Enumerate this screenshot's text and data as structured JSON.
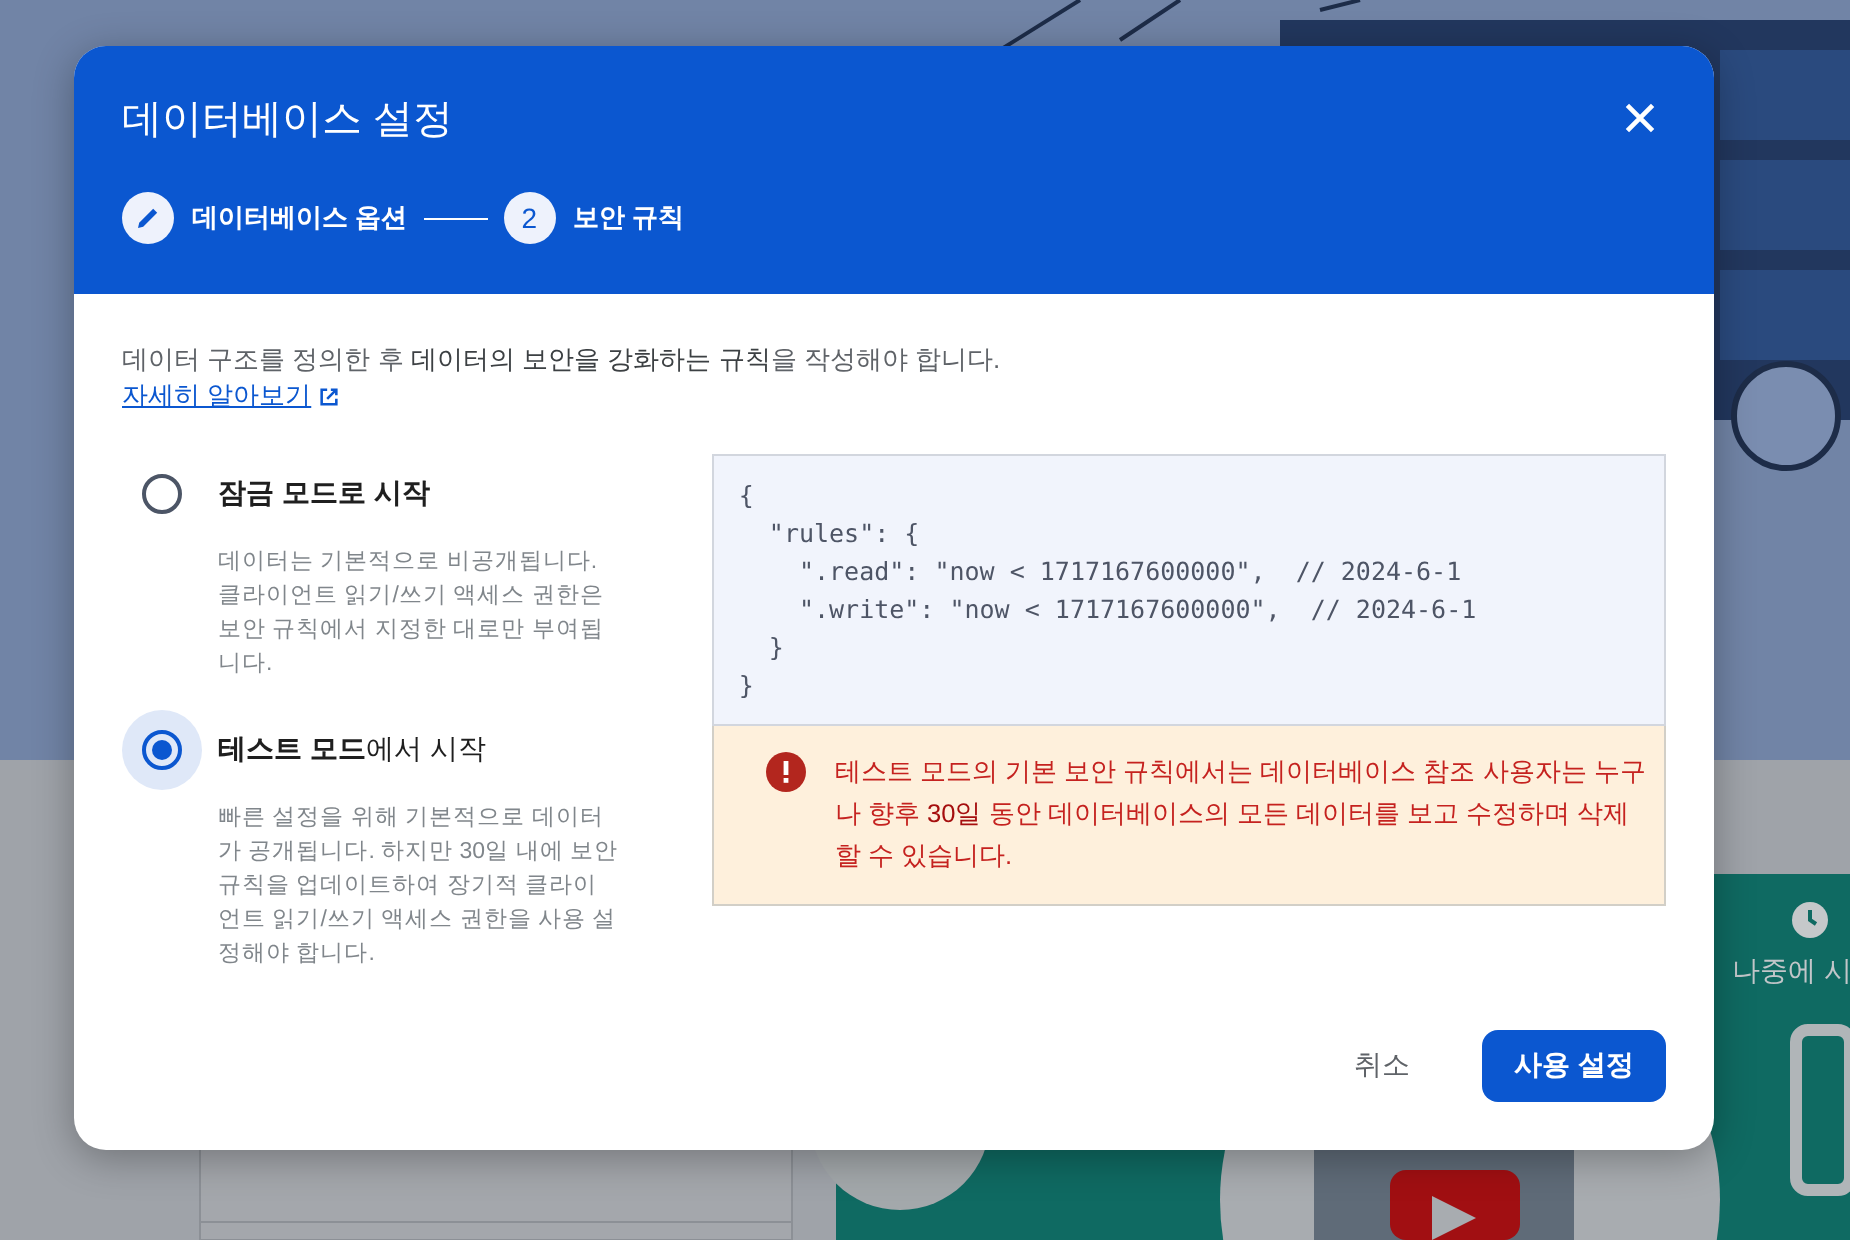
{
  "background": {
    "side_action": "나중에 시"
  },
  "dialog": {
    "title": "데이터베이스 설정"
  },
  "steps": [
    {
      "label": "데이터베이스 옵션",
      "kind": "done"
    },
    {
      "label": "보안 규칙",
      "number": "2",
      "kind": "current"
    }
  ],
  "intro": "데이터 구조를 정의한 후 **데이터의 보안을 강화하는 규칙**을 작성해야 합니다.",
  "link": "자세히 알아보기",
  "options": [
    {
      "title": "**잠금 모드로 시작**",
      "description": "데이터는 기본적으로 비공개됩니다. 클라이언트 읽기/쓰기 액세스 권한은 보안 규칙에서 지정한 대로만 부여됩니다.",
      "selected": false
    },
    {
      "title": "**테스트 모드**에서 시작",
      "description": "빠른 설정을 위해 기본적으로 데이터가 공개됩니다. 하지만 30일 내에 보안 규칙을 업데이트하여 장기적 클라이언트 읽기/쓰기 액세스 권한을 사용 설정해야 합니다.",
      "selected": true
    }
  ],
  "code": [
    "{",
    "  \"rules\": {",
    "    \".read\": \"now < 1717167600000\",  // 2024-6-1",
    "    \".write\": \"now < 1717167600000\",  // 2024-6-1",
    "  }",
    "}"
  ],
  "warning": "테스트 모드의 기본 보안 규칙에서는 데이터베이스 참조 사용자는 누구나 향후 **30일** 동안 데이터베이스의 모든 데이터를 보고 수정하며 삭제할 수 있습니다.",
  "buttons": [
    {
      "label": "취소",
      "kind": "text"
    },
    {
      "label": "사용 설정",
      "kind": "primary"
    }
  ]
}
